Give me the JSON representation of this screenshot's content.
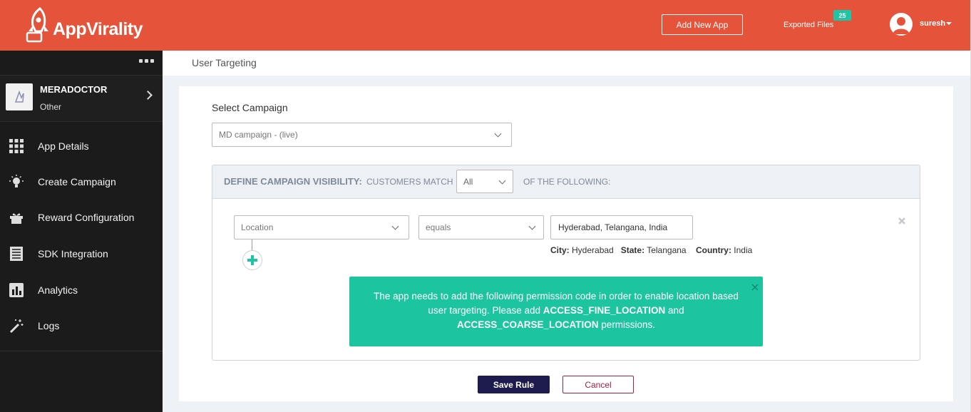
{
  "brand": {
    "name": "AppVirality",
    "color": "#e5543a",
    "accent": "#1cc49f"
  },
  "header": {
    "add_app_label": "Add New App",
    "exported_label": "Exported Files",
    "exported_count": "25",
    "username": "suresh"
  },
  "sidebar": {
    "app": {
      "name": "MERADOCTOR",
      "category": "Other"
    },
    "items": [
      {
        "label": "App Details",
        "icon": "grid-icon"
      },
      {
        "label": "Create Campaign",
        "icon": "bulb-icon"
      },
      {
        "label": "Reward Configuration",
        "icon": "gift-icon"
      },
      {
        "label": "SDK Integration",
        "icon": "code-list-icon"
      },
      {
        "label": "Analytics",
        "icon": "bar-chart-icon"
      },
      {
        "label": "Logs",
        "icon": "magic-wand-icon"
      }
    ]
  },
  "page": {
    "title": "User Targeting"
  },
  "form": {
    "campaign_label": "Select Campaign",
    "campaign_value": "MD campaign - (live)",
    "visibility_title": "DEFINE CAMPAIGN VISIBILITY:",
    "customers_match": "CUSTOMERS MATCH",
    "match_value": "All",
    "of_following": "OF THE FOLLOWING:",
    "rule": {
      "attribute": "Location",
      "operator": "equals",
      "value": "Hyderabad, Telangana, India"
    },
    "location": {
      "city_label": "City:",
      "city": "Hyderabad",
      "state_label": "State:",
      "state": "Telangana",
      "country_label": "Country:",
      "country": "India"
    },
    "alert": {
      "text_1": "The app needs to add the following permission code in order to enable location based user targeting. Please add ",
      "perm_1": "ACCESS_FINE_LOCATION",
      "text_2": " and ",
      "perm_2": "ACCESS_COARSE_LOCATION",
      "text_3": " permissions."
    },
    "save_label": "Save Rule",
    "cancel_label": "Cancel"
  }
}
